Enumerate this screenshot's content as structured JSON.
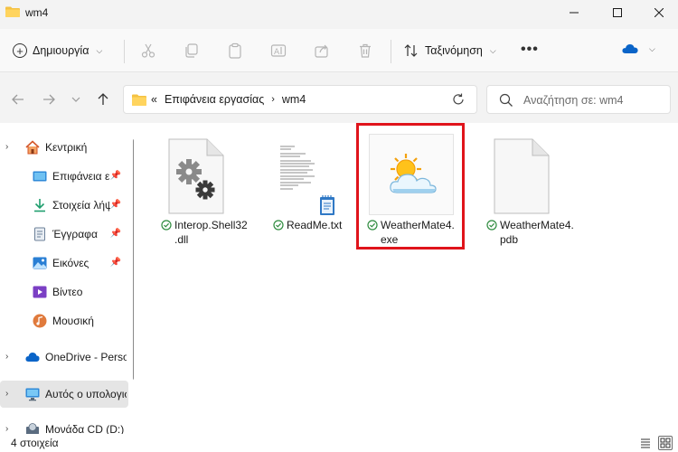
{
  "window": {
    "title": "wm4"
  },
  "toolbar": {
    "new_label": "Δημιουργία",
    "sort_label": "Ταξινόμηση",
    "more_label": "•••"
  },
  "address": {
    "overflow": "«",
    "crumbs": [
      "Επιφάνεια εργασίας",
      "wm4"
    ]
  },
  "search": {
    "placeholder": "Αναζήτηση σε: wm4"
  },
  "sidebar": {
    "items": [
      {
        "label": "Κεντρική",
        "icon": "home-icon"
      },
      {
        "label": "Επιφάνεια εργασίας",
        "icon": "desktop-icon",
        "pinned": true
      },
      {
        "label": "Στοιχεία λήψης",
        "icon": "download-icon",
        "pinned": true
      },
      {
        "label": "Έγγραφα",
        "icon": "documents-icon",
        "pinned": true
      },
      {
        "label": "Εικόνες",
        "icon": "pictures-icon",
        "pinned": true
      },
      {
        "label": "Βίντεο",
        "icon": "video-icon"
      },
      {
        "label": "Μουσική",
        "icon": "music-icon"
      },
      {
        "label": "OneDrive - Personal",
        "icon": "onedrive-icon"
      },
      {
        "label": "Αυτός ο υπολογιστής",
        "icon": "this-pc-icon"
      },
      {
        "label": "Μονάδα CD (D:)",
        "icon": "cd-drive-icon"
      }
    ]
  },
  "files": [
    {
      "name_line1": "Interop.Shell32",
      "name_line2": ".dll",
      "icon": "dll-gear-icon"
    },
    {
      "name_line1": "ReadMe.txt",
      "name_line2": "",
      "icon": "text-document-icon"
    },
    {
      "name_line1": "WeatherMate4.",
      "name_line2": "exe",
      "icon": "weather-app-icon"
    },
    {
      "name_line1": "WeatherMate4.",
      "name_line2": "pdb",
      "icon": "blank-file-icon"
    }
  ],
  "status": {
    "count": "4 στοιχεία"
  },
  "colors": {
    "accent": "#0067c0",
    "highlight": "#e0141b",
    "sync_ok": "#2e8b3e",
    "folder": "#f4c243"
  }
}
